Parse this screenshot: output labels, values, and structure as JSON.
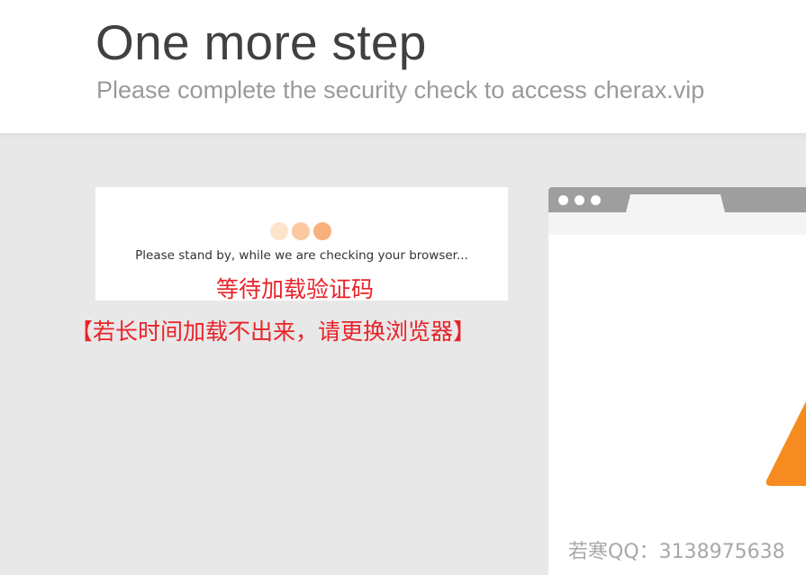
{
  "header": {
    "title": "One more step",
    "subtitle": "Please complete the security check to access cherax.vip"
  },
  "check": {
    "status": "Please stand by, while we are checking your browser...",
    "loader_colors": [
      "#fde3cc",
      "#fbc8a0",
      "#f8b07c"
    ]
  },
  "annotations": {
    "line1": "等待加载验证码",
    "line2": "【若长时间加载不出来，请更换浏览器】",
    "color": "#e8232a"
  },
  "browser_illustration": {
    "bar_color": "#9e9e9e",
    "accent_color": "#f68b1f"
  },
  "watermark": "若寒QQ：3138975638"
}
